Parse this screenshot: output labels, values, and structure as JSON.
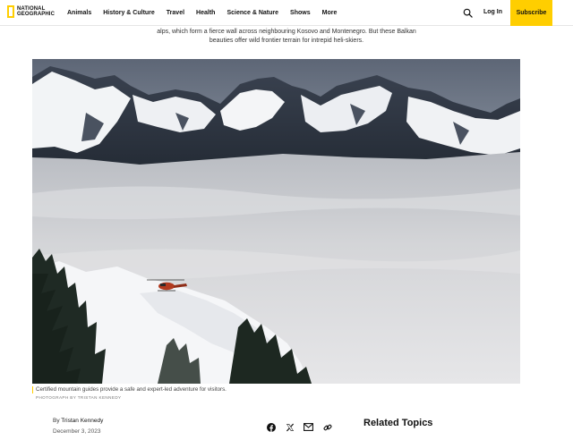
{
  "header": {
    "logo_line1": "NATIONAL",
    "logo_line2": "GEOGRAPHIC",
    "nav": [
      "Animals",
      "History & Culture",
      "Travel",
      "Health",
      "Science & Nature",
      "Shows",
      "More"
    ],
    "login_label": "Log In",
    "subscribe_label": "Subscribe",
    "accent_color": "#ffce00"
  },
  "article": {
    "intro_line1": "alps, which form a fierce wall across neighbouring Kosovo and Montenegro. But these Balkan",
    "intro_line2": "beauties offer wild frontier terrain for intrepid heli-skiers.",
    "photo_caption": "Certified mountain guides provide a safe and expert-led adventure for visitors.",
    "photo_credit": "PHOTOGRAPH BY TRISTAN KENNEDY",
    "byline_prefix": "By ",
    "author": "Tristan Kennedy",
    "date": "December 3, 2023",
    "related_heading": "Related Topics"
  },
  "share_icons": [
    "facebook-icon",
    "x-icon",
    "email-icon",
    "link-icon"
  ]
}
